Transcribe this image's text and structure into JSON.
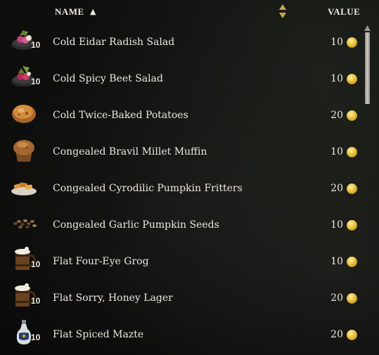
{
  "header": {
    "name_label": "NAME",
    "name_sort_glyph": "▲",
    "value_label": "VALUE",
    "sort_icon": "sort-toggle-icon"
  },
  "colors": {
    "text": "#ece8dc",
    "coin": "#e0b52a",
    "background": "#0b0b0b"
  },
  "items": [
    {
      "name": "Cold Eidar Radish Salad",
      "qty": "10",
      "value": "10",
      "icon": "salad-bowl-icon"
    },
    {
      "name": "Cold Spicy Beet Salad",
      "qty": "10",
      "value": "10",
      "icon": "salad-bowl-icon"
    },
    {
      "name": "Cold Twice-Baked Potatoes",
      "qty": "",
      "value": "20",
      "icon": "potato-icon"
    },
    {
      "name": "Congealed Bravil Millet Muffin",
      "qty": "",
      "value": "10",
      "icon": "muffin-icon"
    },
    {
      "name": "Congealed Cyrodilic Pumpkin Fritters",
      "qty": "",
      "value": "20",
      "icon": "fritters-icon"
    },
    {
      "name": "Congealed Garlic Pumpkin Seeds",
      "qty": "",
      "value": "10",
      "icon": "seeds-icon"
    },
    {
      "name": "Flat Four-Eye Grog",
      "qty": "10",
      "value": "10",
      "icon": "tankard-icon"
    },
    {
      "name": "Flat Sorry, Honey Lager",
      "qty": "10",
      "value": "20",
      "icon": "tankard-icon"
    },
    {
      "name": "Flat Spiced Mazte",
      "qty": "10",
      "value": "20",
      "icon": "bottle-icon"
    }
  ]
}
